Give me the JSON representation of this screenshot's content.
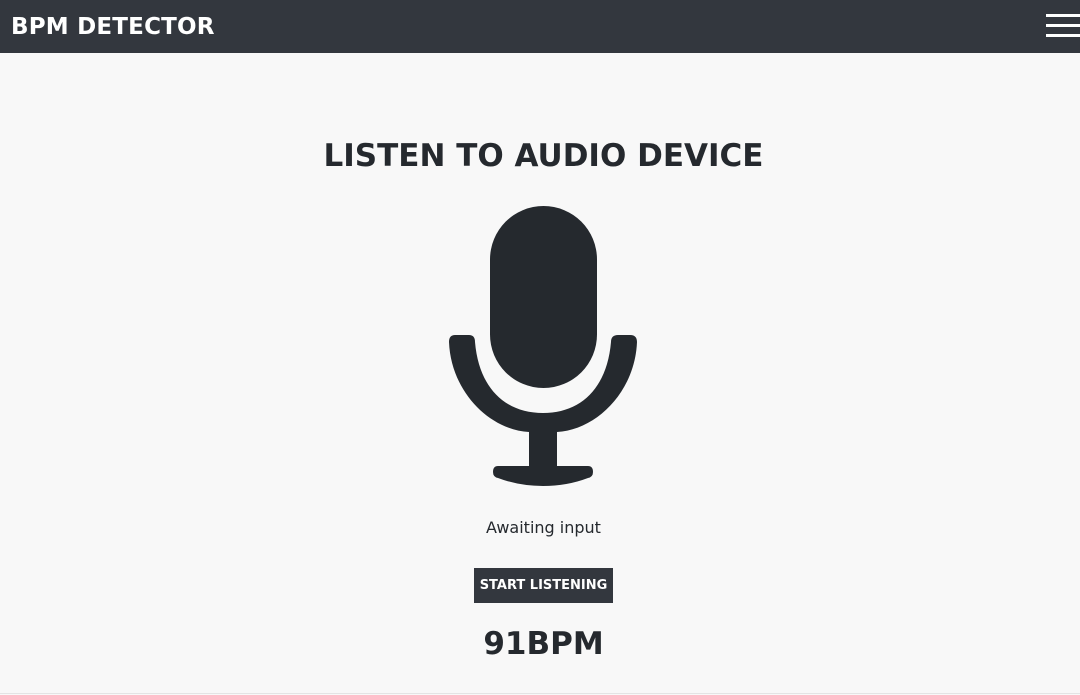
{
  "navbar": {
    "brand": "BPM DETECTOR",
    "menu_icon": "hamburger-menu-icon"
  },
  "main": {
    "title": "LISTEN TO AUDIO DEVICE",
    "mic_icon": "microphone-icon",
    "status": "Awaiting input",
    "start_button_label": "START LISTENING",
    "bpm_value": "91BPM"
  },
  "colors": {
    "navbar_bg": "#33373e",
    "page_bg": "#f8f8f8",
    "text": "#25292e",
    "button_bg": "#33373e",
    "button_text": "#ffffff"
  }
}
